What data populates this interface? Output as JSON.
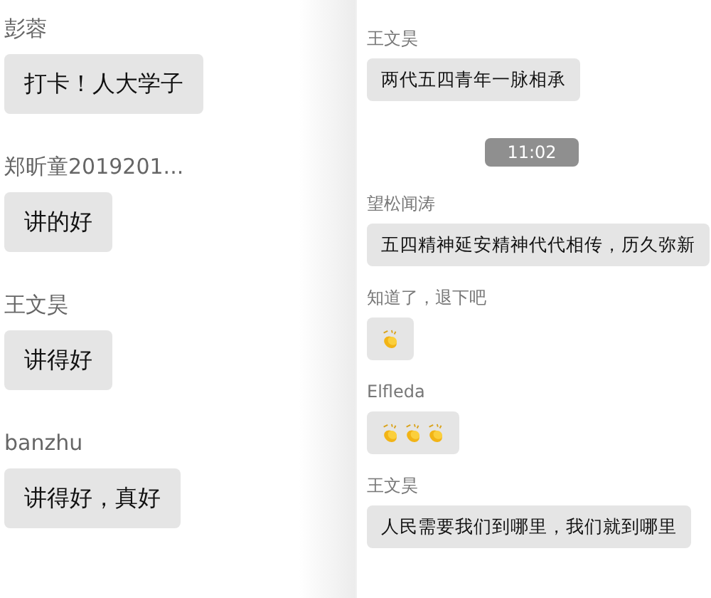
{
  "left_panel": {
    "messages": [
      {
        "sender": "彭蓉",
        "kind": "text",
        "text": "打卡！人大学子"
      },
      {
        "sender": "郑昕童2019201...",
        "kind": "text",
        "text": "讲的好"
      },
      {
        "sender": "王文昊",
        "kind": "text",
        "text": "讲得好"
      },
      {
        "sender": "banzhu",
        "kind": "text",
        "text": "讲得好，真好"
      }
    ]
  },
  "right_panel": {
    "messages": [
      {
        "kind": "text",
        "sender": "王文昊",
        "text": "两代五四青年一脉相承"
      },
      {
        "kind": "time",
        "text": "11:02"
      },
      {
        "kind": "text",
        "sender": "望松闻涛",
        "text": "五四精神延安精神代代相传，历久弥新"
      },
      {
        "kind": "icons",
        "sender": "知道了，退下吧",
        "icons": [
          {
            "kind": "clap"
          }
        ]
      },
      {
        "kind": "icons",
        "sender": "Elfleda",
        "icons": [
          {
            "kind": "clap"
          },
          {
            "kind": "clap"
          },
          {
            "kind": "clap"
          }
        ]
      },
      {
        "kind": "text",
        "sender": "王文昊",
        "text": "人民需要我们到哪里，我们就到哪里"
      }
    ]
  }
}
